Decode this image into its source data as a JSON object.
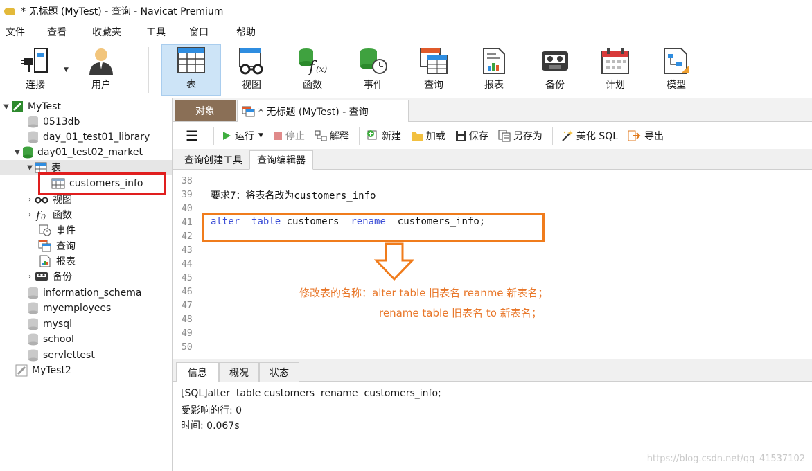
{
  "window": {
    "title": "* 无标题 (MyTest) - 查询 - Navicat Premium"
  },
  "menu": [
    "文件",
    "查看",
    "收藏夹",
    "工具",
    "窗口",
    "帮助"
  ],
  "ribbon": {
    "connect": "连接",
    "user": "用户",
    "table": "表",
    "view": "视图",
    "function": "函数",
    "event": "事件",
    "query": "查询",
    "report": "报表",
    "backup": "备份",
    "schedule": "计划",
    "model": "模型"
  },
  "tree": {
    "conn1": "MyTest",
    "db_0513": "0513db",
    "db_library": "day_01_test01_library",
    "db_market": "day01_test02_market",
    "node_tables": "表",
    "table_customers_info": "customers_info",
    "node_views": "视图",
    "node_functions": "函数",
    "node_events": "事件",
    "node_queries": "查询",
    "node_reports": "报表",
    "node_backups": "备份",
    "db_info_schema": "information_schema",
    "db_myemployees": "myemployees",
    "db_mysql": "mysql",
    "db_school": "school",
    "db_servlettest": "servlettest",
    "conn2": "MyTest2"
  },
  "tabs": {
    "objects": "对象",
    "query": "* 无标题 (MyTest) - 查询"
  },
  "toolbar": {
    "run": "运行",
    "stop": "停止",
    "explain": "解释",
    "new": "新建",
    "load": "加载",
    "save": "保存",
    "save_as": "另存为",
    "beautify": "美化 SQL",
    "export": "导出"
  },
  "subtabs": {
    "builder": "查询创建工具",
    "editor": "查询编辑器"
  },
  "editor": {
    "line_numbers": [
      "38",
      "39",
      "40",
      "41",
      "42",
      "43",
      "44",
      "45",
      "46",
      "47",
      "48",
      "49",
      "50"
    ],
    "comment_line": "要求7：将表名改为customers_info",
    "sql": {
      "kw_alter": "alter",
      "kw_table": "table",
      "ident_old": "customers",
      "kw_rename": "rename",
      "ident_new": "customers_info;"
    }
  },
  "annotation": {
    "line1": "修改表的名称：alter   table  旧表名    reanme  新表名；",
    "line2": "rename  table 旧表名  to 新表名；"
  },
  "colors": {
    "annotation": "#e8772a",
    "sql_keyword": "#3d4fd6",
    "highlight_red": "#e01e1e",
    "highlight_orange": "#f07c1c",
    "object_tab": "#8a6f56"
  },
  "bottom_tabs": {
    "info": "信息",
    "overview": "概况",
    "status": "状态"
  },
  "output": {
    "line1": "[SQL]alter  table customers  rename  customers_info;",
    "line2": "受影响的行: 0",
    "line3": "时间: 0.067s"
  },
  "watermark": "https://blog.csdn.net/qq_41537102"
}
